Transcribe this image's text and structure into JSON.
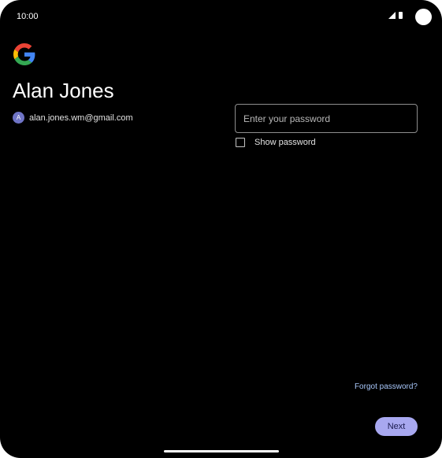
{
  "status_bar": {
    "time": "10:00",
    "icons": [
      "signal-icon",
      "battery-icon",
      "camera-cutout"
    ]
  },
  "brand": {
    "icon": "google-logo-icon"
  },
  "account": {
    "name": "Alan Jones",
    "avatar_letter": "A",
    "email": "alan.jones.wm@gmail.com"
  },
  "password": {
    "placeholder": "Enter your password",
    "value": ""
  },
  "show_password": {
    "label": "Show password",
    "checked": false
  },
  "forgot_password": {
    "label": "Forgot password?"
  },
  "next_button": {
    "label": "Next"
  },
  "colors": {
    "background": "#000000",
    "link": "#a8c7fa",
    "button": "#a8a8f0",
    "avatar": "#6f74c6"
  }
}
